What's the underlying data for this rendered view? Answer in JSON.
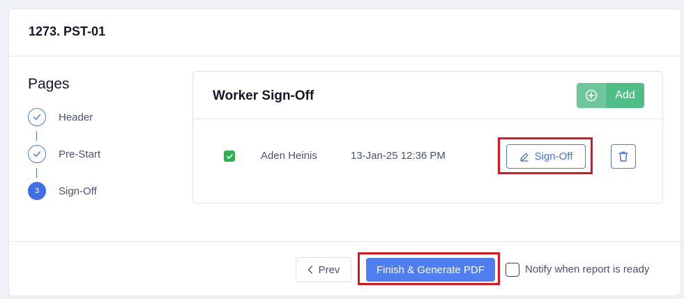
{
  "card": {
    "title": "1273. PST-01"
  },
  "pages": {
    "title": "Pages",
    "steps": [
      {
        "label": "Header",
        "state": "done",
        "icon": "check-icon"
      },
      {
        "label": "Pre-Start",
        "state": "done",
        "icon": "check-icon"
      },
      {
        "label": "Sign-Off",
        "state": "active",
        "number": "3"
      }
    ]
  },
  "panel": {
    "title": "Worker Sign-Off",
    "add_label": "Add",
    "add_icon": "plus-circle-icon",
    "rows": [
      {
        "checked": true,
        "name": "Aden Heinis",
        "timestamp": "13-Jan-25 12:36 PM",
        "signoff_label": "Sign-Off",
        "signoff_icon": "pencil-icon",
        "delete_icon": "trash-icon"
      }
    ]
  },
  "footer": {
    "prev_label": "Prev",
    "finish_label": "Finish & Generate PDF",
    "notify_label": "Notify when report is ready",
    "notify_checked": false
  },
  "colors": {
    "primary": "#4f7ef0",
    "success": "#4ebd86",
    "checkbox_green": "#2fb14f",
    "highlight": "#e0141e"
  }
}
